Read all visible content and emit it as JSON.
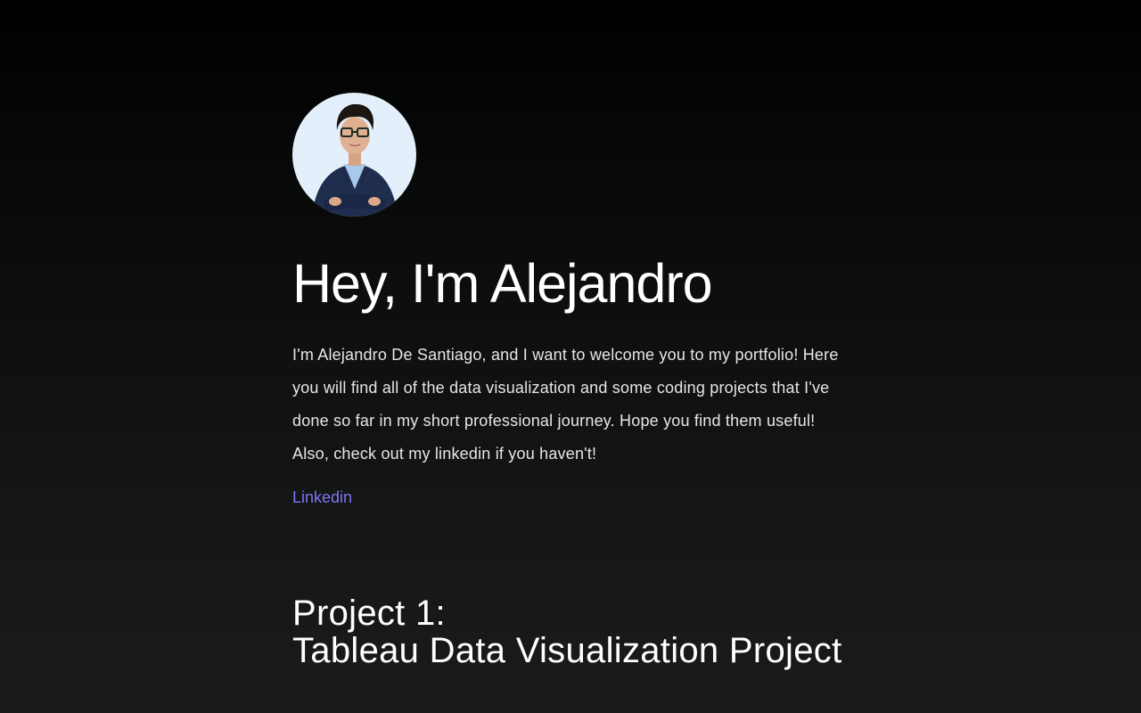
{
  "profile": {
    "avatar_icon": "person-portrait-icon",
    "avatar_bg_color": "#e3f0fb"
  },
  "hero": {
    "title": "Hey, I'm Alejandro",
    "paragraph_1": "I'm Alejandro De Santiago, and I want to welcome you to my portfolio! Here you will find all of the data visualization and some coding projects that I've done so far in my short professional journey. Hope you find them useful!",
    "paragraph_2": "Also, check out my linkedin if you haven't!",
    "link_label": "Linkedin",
    "link_color": "#7b76f2"
  },
  "project": {
    "title_line_1": "Project 1:",
    "title_line_2": "Tableau Data Visualization Project"
  }
}
